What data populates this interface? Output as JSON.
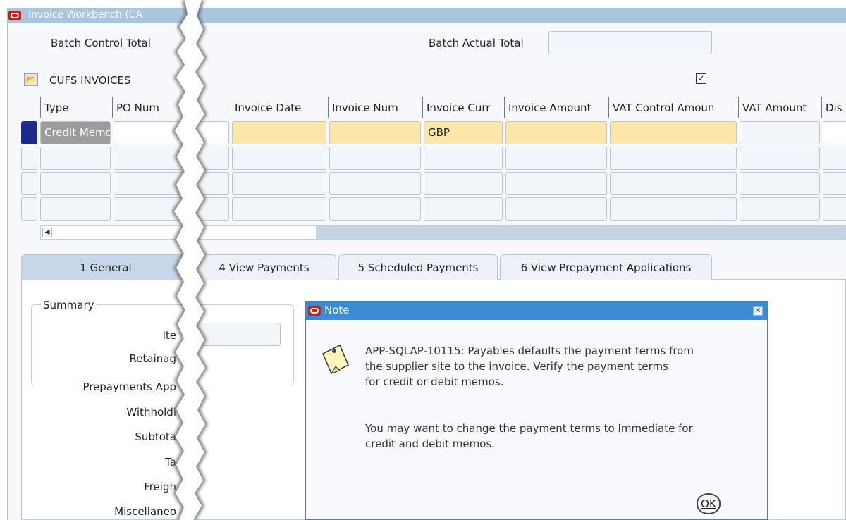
{
  "window": {
    "title": "Invoice Workbench (CA"
  },
  "header": {
    "batch_control_total_label": "Batch Control Total",
    "batch_actual_total_label": "Batch Actual Total",
    "batch_actual_total_value": ""
  },
  "block": {
    "title": "CUFS INVOICES",
    "checkbox_checked": "✓"
  },
  "table": {
    "columns": [
      "Type",
      "PO Num",
      "Invoice Date",
      "Invoice Num",
      "Invoice Curr",
      "Invoice Amount",
      "VAT Control Amoun",
      "VAT Amount",
      "Dis"
    ],
    "rows": [
      {
        "type": "Credit Memo",
        "po_num": "",
        "invoice_date": "",
        "invoice_num": "",
        "invoice_curr": "GBP",
        "invoice_amount": "",
        "vat_control_amount": "",
        "vat_amount": ""
      }
    ]
  },
  "tabs": [
    {
      "label": "1 General"
    },
    {
      "label": "4 View Payments"
    },
    {
      "label": "5 Scheduled Payments"
    },
    {
      "label": "6 View Prepayment Applications"
    }
  ],
  "summary": {
    "legend": "Summary",
    "items": [
      "Ite",
      "Retainag",
      "Prepayments App",
      "Withholdi",
      "Subtota",
      "Ta",
      "Freigh",
      "Miscellaneo"
    ]
  },
  "dialog": {
    "title": "Note",
    "message_1": "APP-SQLAP-10115: Payables defaults the payment terms from",
    "message_2": "the supplier site to the invoice.  Verify the payment terms",
    "message_3": "for credit or debit memos.",
    "message_4": "You may want to change the payment terms to Immediate for",
    "message_5": "credit and debit memos.",
    "ok_label": "OK"
  },
  "colors": {
    "title_bar": "#a8c6df",
    "dialog_title_bar": "#3a8bd0",
    "required_field": "#fde7a8",
    "oracle_red": "#cc1c14"
  }
}
